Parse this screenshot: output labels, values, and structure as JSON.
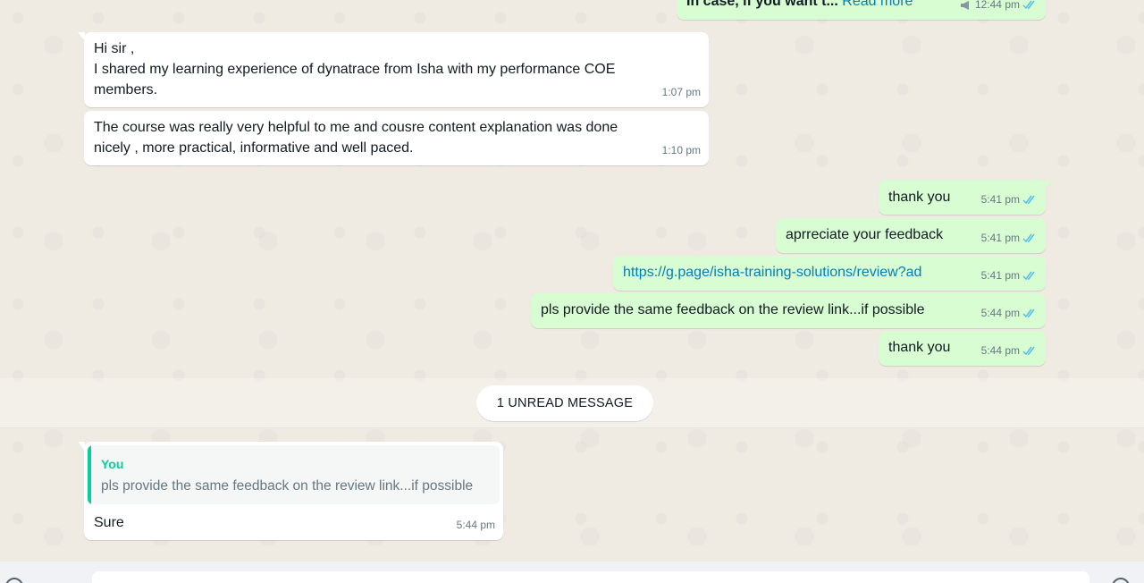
{
  "colors": {
    "background": "#efeae2",
    "incoming_bubble": "#ffffff",
    "outgoing_bubble": "#d9fdd3",
    "read_ticks": "#53bdeb",
    "link": "#027eb5",
    "quote_accent": "#06cf9c"
  },
  "messages": {
    "top_partial": {
      "text": "In case, if you want t...",
      "read_more": "Read more",
      "time": "12:44 pm",
      "icon": "megaphone-icon"
    },
    "m1": {
      "text": "Hi sir ,\nI shared my learning experience  of dynatrace from Isha with my  performance COE members.",
      "time": "1:07 pm"
    },
    "m2": {
      "text": "The course was really very helpful to me and cousre content explanation was done nicely , more practical,  informative and well paced.",
      "time": "1:10 pm"
    },
    "m3": {
      "text": "thank you",
      "time": "5:41 pm"
    },
    "m4": {
      "text": "aprreciate your feedback",
      "time": "5:41 pm"
    },
    "m5": {
      "text": "https://g.page/isha-training-solutions/review?ad",
      "time": "5:41 pm"
    },
    "m6": {
      "text": "pls provide the same feedback on the review link...if possible",
      "time": "5:44 pm"
    },
    "m7": {
      "text": "thank you",
      "time": "5:44 pm"
    }
  },
  "unread": {
    "label": "1 UNREAD MESSAGE"
  },
  "reply": {
    "quote_author": "You",
    "quote_text": "pls provide the same feedback on the review link...if possible",
    "text": "Sure",
    "time": "5:44 pm"
  }
}
